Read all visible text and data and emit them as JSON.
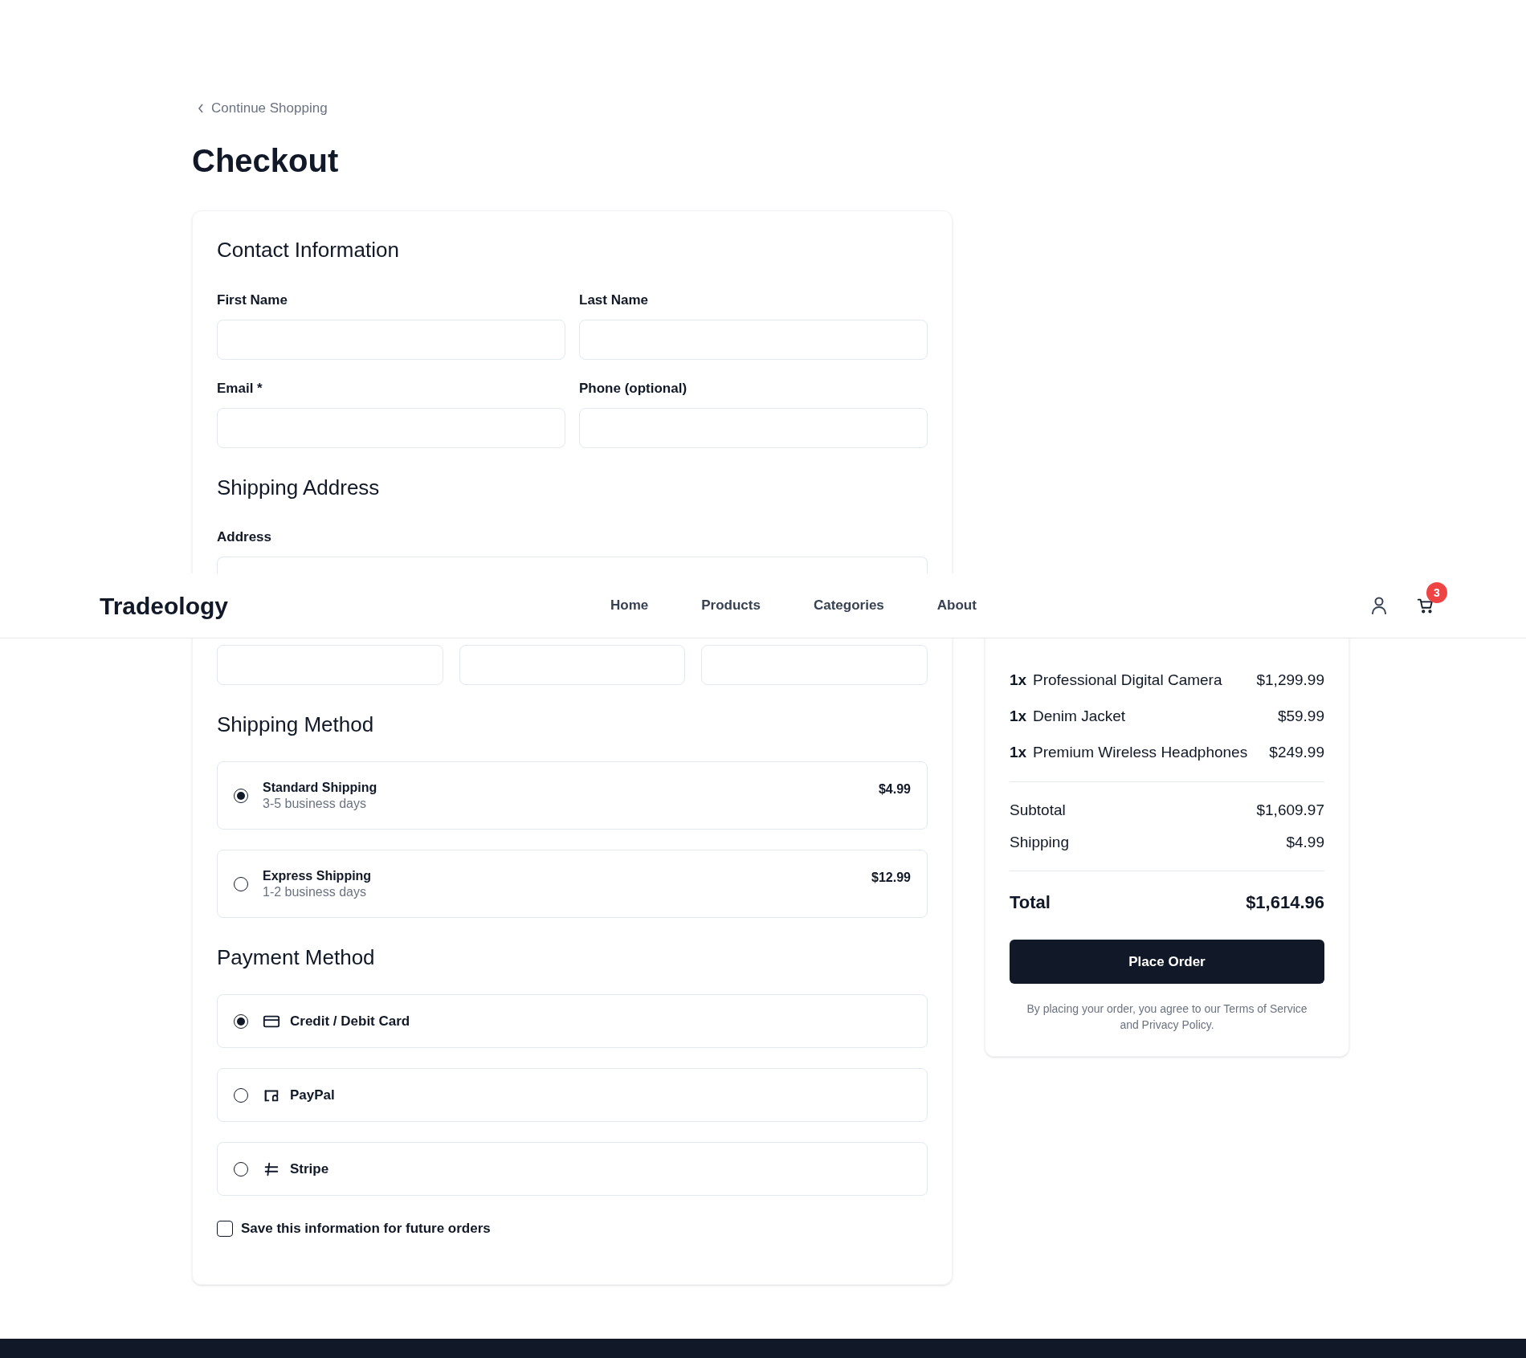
{
  "header": {
    "logo": "Tradeology",
    "nav": [
      {
        "label": "Home"
      },
      {
        "label": "Products"
      },
      {
        "label": "Categories"
      },
      {
        "label": "About"
      }
    ],
    "cart_count": "3"
  },
  "back_link": "Continue Shopping",
  "title": "Checkout",
  "contact": {
    "heading": "Contact Information",
    "fields": [
      {
        "label": "First Name"
      },
      {
        "label": "Last Name"
      },
      {
        "label": "Email *"
      },
      {
        "label": "Phone (optional)"
      }
    ]
  },
  "shipping_address": {
    "heading": "Shipping Address",
    "address_label": "Address",
    "extra_fields": [
      {
        "kind": "text"
      },
      {
        "kind": "text"
      },
      {
        "kind": "text"
      }
    ]
  },
  "shipping_method": {
    "heading": "Shipping Method",
    "options": [
      {
        "name": "Standard Shipping",
        "time": "3-5 business days",
        "price": "$4.99",
        "selected": true
      },
      {
        "name": "Express Shipping",
        "time": "1-2 business days",
        "price": "$12.99",
        "selected": false
      }
    ]
  },
  "payment_method": {
    "heading": "Payment Method",
    "options": [
      {
        "name": "Credit / Debit Card",
        "selected": true
      },
      {
        "name": "PayPal",
        "selected": false
      },
      {
        "name": "Stripe",
        "selected": false
      }
    ]
  },
  "save_info": {
    "label": "Save this information for future orders",
    "checked": false
  },
  "summary": {
    "items": [
      {
        "qty": "1x",
        "name": "Professional Digital Camera",
        "price": "$1,299.99"
      },
      {
        "qty": "1x",
        "name": "Denim Jacket",
        "price": "$59.99"
      },
      {
        "qty": "1x",
        "name": "Premium Wireless Headphones",
        "price": "$249.99"
      }
    ],
    "subtotal_label": "Subtotal",
    "subtotal": "$1,609.97",
    "shipping_label": "Shipping",
    "shipping": "$4.99",
    "total_label": "Total",
    "total": "$1,614.96",
    "button": "Place Order",
    "terms": "By placing your order, you agree to our Terms of Service and Privacy Policy."
  }
}
